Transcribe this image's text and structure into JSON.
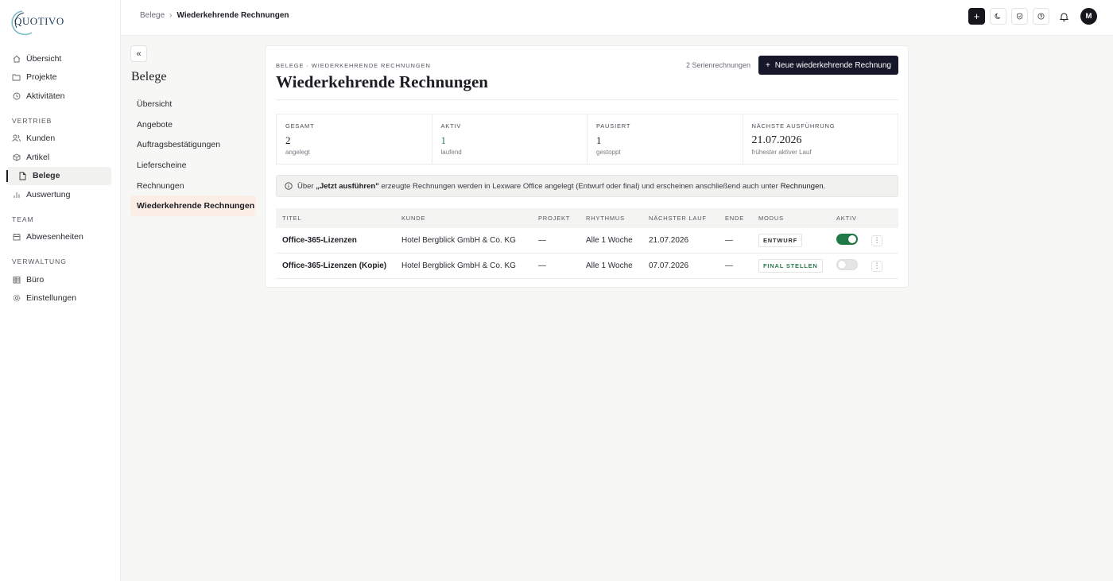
{
  "app": {
    "logo_text": "QUOTIVO"
  },
  "sidebar": {
    "items_top": [
      {
        "label": "Übersicht",
        "icon": "home-icon"
      },
      {
        "label": "Projekte",
        "icon": "folder-icon"
      },
      {
        "label": "Aktivitäten",
        "icon": "clock-icon"
      }
    ],
    "section_vertrieb": "VERTRIEB",
    "items_vertrieb": [
      {
        "label": "Kunden",
        "icon": "users-icon"
      },
      {
        "label": "Artikel",
        "icon": "box-icon"
      },
      {
        "label": "Belege",
        "icon": "document-icon",
        "active": true
      },
      {
        "label": "Auswertung",
        "icon": "bar-chart-icon"
      }
    ],
    "section_team": "TEAM",
    "items_team": [
      {
        "label": "Abwesenheiten",
        "icon": "calendar-icon"
      }
    ],
    "section_verwaltung": "VERWALTUNG",
    "items_verwaltung": [
      {
        "label": "Büro",
        "icon": "building-icon"
      },
      {
        "label": "Einstellungen",
        "icon": "gear-icon"
      }
    ]
  },
  "topbar": {
    "breadcrumb_root": "Belege",
    "breadcrumb_sep": "›",
    "breadcrumb_current": "Wiederkehrende Rechnungen",
    "avatar_initial": "M"
  },
  "subnav": {
    "title": "Belege",
    "items": [
      "Übersicht",
      "Angebote",
      "Auftragsbestätigungen",
      "Lieferscheine",
      "Rechnungen",
      "Wiederkehrende Rechnungen"
    ],
    "active_index": 5
  },
  "page": {
    "eyebrow": "BELEGE · WIEDERKEHRENDE RECHNUNGEN",
    "title": "Wiederkehrende Rechnungen",
    "count": "2 Serienrechnungen",
    "primary_button": "Neue wiederkehrende Rechnung"
  },
  "stats": [
    {
      "label": "GESAMT",
      "value": "2",
      "sub": "angelegt"
    },
    {
      "label": "AKTIV",
      "value": "1",
      "sub": "laufend",
      "color": "#2f7d4f"
    },
    {
      "label": "PAUSIERT",
      "value": "1",
      "sub": "gestoppt"
    },
    {
      "label": "NÄCHSTE AUSFÜHRUNG",
      "value": "21.07.2026",
      "sub": "frühester aktiver Lauf"
    }
  ],
  "info": {
    "prefix": "Über",
    "bold": "„Jetzt ausführen\"",
    "middle": "erzeugte Rechnungen werden in Lexware Office angelegt (Entwurf oder final) und erscheinen anschließend auch unter",
    "link": "Rechnungen."
  },
  "table": {
    "headers": [
      "TITEL",
      "KUNDE",
      "PROJEKT",
      "RHYTHMUS",
      "NÄCHSTER LAUF",
      "ENDE",
      "MODUS",
      "AKTIV"
    ],
    "rows": [
      {
        "titel": "Office-365-Lizenzen",
        "kunde": "Hotel Bergblick GmbH & Co. KG",
        "projekt": "—",
        "rhythmus": "Alle 1 Woche",
        "naechster_lauf": "21.07.2026",
        "ende": "—",
        "modus": "ENTWURF",
        "aktiv": true
      },
      {
        "titel": "Office-365-Lizenzen (Kopie)",
        "kunde": "Hotel Bergblick GmbH & Co. KG",
        "projekt": "—",
        "rhythmus": "Alle 1 Woche",
        "naechster_lauf": "07.07.2026",
        "ende": "—",
        "modus": "FINAL STELLEN",
        "aktiv": false
      }
    ]
  },
  "colors": {
    "accent_dark": "#16182a",
    "green": "#1f7a45",
    "active_subnav_bg": "#fbeee6"
  }
}
